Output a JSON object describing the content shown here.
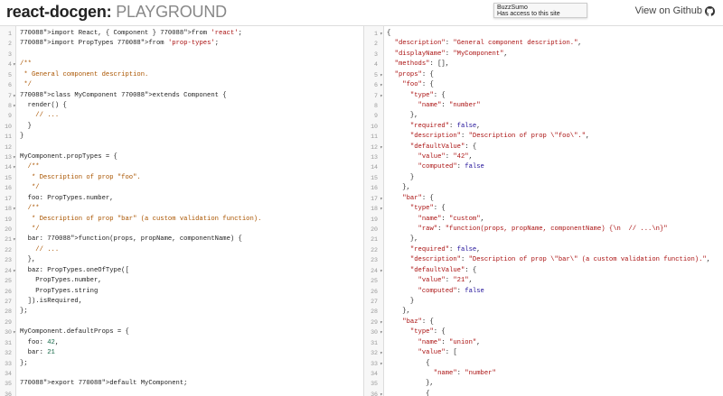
{
  "header": {
    "title_main": "react-docgen:",
    "title_sub": " PLAYGROUND",
    "github_link": "View on Github",
    "tooltip_line1": "BuzzSumo",
    "tooltip_line2": "Has access to this site"
  },
  "editor": {
    "lines": [
      {
        "n": "1",
        "fold": "",
        "text": "import React, { Component } from 'react';"
      },
      {
        "n": "2",
        "fold": "",
        "text": "import PropTypes from 'prop-types';"
      },
      {
        "n": "3",
        "fold": "",
        "text": ""
      },
      {
        "n": "4",
        "fold": "▾",
        "text": "/**"
      },
      {
        "n": "5",
        "fold": "",
        "text": " * General component description."
      },
      {
        "n": "6",
        "fold": "",
        "text": " */"
      },
      {
        "n": "7",
        "fold": "▾",
        "text": "class MyComponent extends Component {"
      },
      {
        "n": "8",
        "fold": "▾",
        "text": "  render() {"
      },
      {
        "n": "9",
        "fold": "",
        "text": "    // ..."
      },
      {
        "n": "10",
        "fold": "",
        "text": "  }"
      },
      {
        "n": "11",
        "fold": "",
        "text": "}"
      },
      {
        "n": "12",
        "fold": "",
        "text": ""
      },
      {
        "n": "13",
        "fold": "▾",
        "text": "MyComponent.propTypes = {"
      },
      {
        "n": "14",
        "fold": "▾",
        "text": "  /**"
      },
      {
        "n": "15",
        "fold": "",
        "text": "   * Description of prop \"foo\"."
      },
      {
        "n": "16",
        "fold": "",
        "text": "   */"
      },
      {
        "n": "17",
        "fold": "",
        "text": "  foo: PropTypes.number,"
      },
      {
        "n": "18",
        "fold": "▾",
        "text": "  /**"
      },
      {
        "n": "19",
        "fold": "",
        "text": "   * Description of prop \"bar\" (a custom validation function)."
      },
      {
        "n": "20",
        "fold": "",
        "text": "   */"
      },
      {
        "n": "21",
        "fold": "▾",
        "text": "  bar: function(props, propName, componentName) {"
      },
      {
        "n": "22",
        "fold": "",
        "text": "    // ..."
      },
      {
        "n": "23",
        "fold": "",
        "text": "  },"
      },
      {
        "n": "24",
        "fold": "▾",
        "text": "  baz: PropTypes.oneOfType(["
      },
      {
        "n": "25",
        "fold": "",
        "text": "    PropTypes.number,"
      },
      {
        "n": "26",
        "fold": "",
        "text": "    PropTypes.string"
      },
      {
        "n": "27",
        "fold": "",
        "text": "  ]).isRequired,"
      },
      {
        "n": "28",
        "fold": "",
        "text": "};"
      },
      {
        "n": "29",
        "fold": "",
        "text": ""
      },
      {
        "n": "30",
        "fold": "▾",
        "text": "MyComponent.defaultProps = {"
      },
      {
        "n": "31",
        "fold": "",
        "text": "  foo: 42,"
      },
      {
        "n": "32",
        "fold": "",
        "text": "  bar: 21"
      },
      {
        "n": "33",
        "fold": "",
        "text": "};"
      },
      {
        "n": "34",
        "fold": "",
        "text": ""
      },
      {
        "n": "35",
        "fold": "",
        "text": "export default MyComponent;"
      },
      {
        "n": "36",
        "fold": "",
        "text": ""
      }
    ]
  },
  "output": {
    "lines": [
      {
        "n": "1",
        "fold": "▾",
        "text": "{"
      },
      {
        "n": "2",
        "fold": "",
        "text": "  \"description\": \"General component description.\","
      },
      {
        "n": "3",
        "fold": "",
        "text": "  \"displayName\": \"MyComponent\","
      },
      {
        "n": "4",
        "fold": "",
        "text": "  \"methods\": [],"
      },
      {
        "n": "5",
        "fold": "▾",
        "text": "  \"props\": {"
      },
      {
        "n": "6",
        "fold": "▾",
        "text": "    \"foo\": {"
      },
      {
        "n": "7",
        "fold": "▾",
        "text": "      \"type\": {"
      },
      {
        "n": "8",
        "fold": "",
        "text": "        \"name\": \"number\""
      },
      {
        "n": "9",
        "fold": "",
        "text": "      },"
      },
      {
        "n": "10",
        "fold": "",
        "text": "      \"required\": false,"
      },
      {
        "n": "11",
        "fold": "",
        "text": "      \"description\": \"Description of prop \\\"foo\\\".\","
      },
      {
        "n": "12",
        "fold": "▾",
        "text": "      \"defaultValue\": {"
      },
      {
        "n": "13",
        "fold": "",
        "text": "        \"value\": \"42\","
      },
      {
        "n": "14",
        "fold": "",
        "text": "        \"computed\": false"
      },
      {
        "n": "15",
        "fold": "",
        "text": "      }"
      },
      {
        "n": "16",
        "fold": "",
        "text": "    },"
      },
      {
        "n": "17",
        "fold": "▾",
        "text": "    \"bar\": {"
      },
      {
        "n": "18",
        "fold": "▾",
        "text": "      \"type\": {"
      },
      {
        "n": "19",
        "fold": "",
        "text": "        \"name\": \"custom\","
      },
      {
        "n": "20",
        "fold": "",
        "text": "        \"raw\": \"function(props, propName, componentName) {\\n  // ...\\n}\""
      },
      {
        "n": "21",
        "fold": "",
        "text": "      },"
      },
      {
        "n": "22",
        "fold": "",
        "text": "      \"required\": false,"
      },
      {
        "n": "23",
        "fold": "",
        "text": "      \"description\": \"Description of prop \\\"bar\\\" (a custom validation function).\","
      },
      {
        "n": "24",
        "fold": "▾",
        "text": "      \"defaultValue\": {"
      },
      {
        "n": "25",
        "fold": "",
        "text": "        \"value\": \"21\","
      },
      {
        "n": "26",
        "fold": "",
        "text": "        \"computed\": false"
      },
      {
        "n": "27",
        "fold": "",
        "text": "      }"
      },
      {
        "n": "28",
        "fold": "",
        "text": "    },"
      },
      {
        "n": "29",
        "fold": "▾",
        "text": "    \"baz\": {"
      },
      {
        "n": "30",
        "fold": "▾",
        "text": "      \"type\": {"
      },
      {
        "n": "31",
        "fold": "",
        "text": "        \"name\": \"union\","
      },
      {
        "n": "32",
        "fold": "▾",
        "text": "        \"value\": ["
      },
      {
        "n": "33",
        "fold": "▾",
        "text": "          {"
      },
      {
        "n": "34",
        "fold": "",
        "text": "            \"name\": \"number\""
      },
      {
        "n": "35",
        "fold": "",
        "text": "          },"
      },
      {
        "n": "36",
        "fold": "▾",
        "text": "          {"
      }
    ]
  },
  "colors": {
    "keyword": "#770088",
    "string": "#aa1111",
    "comment": "#aa5500",
    "def": "#0000ff",
    "variable": "#0055aa",
    "atom": "#221199",
    "property": "#000000",
    "number": "#116644"
  },
  "icons": {
    "github": "github-icon"
  }
}
